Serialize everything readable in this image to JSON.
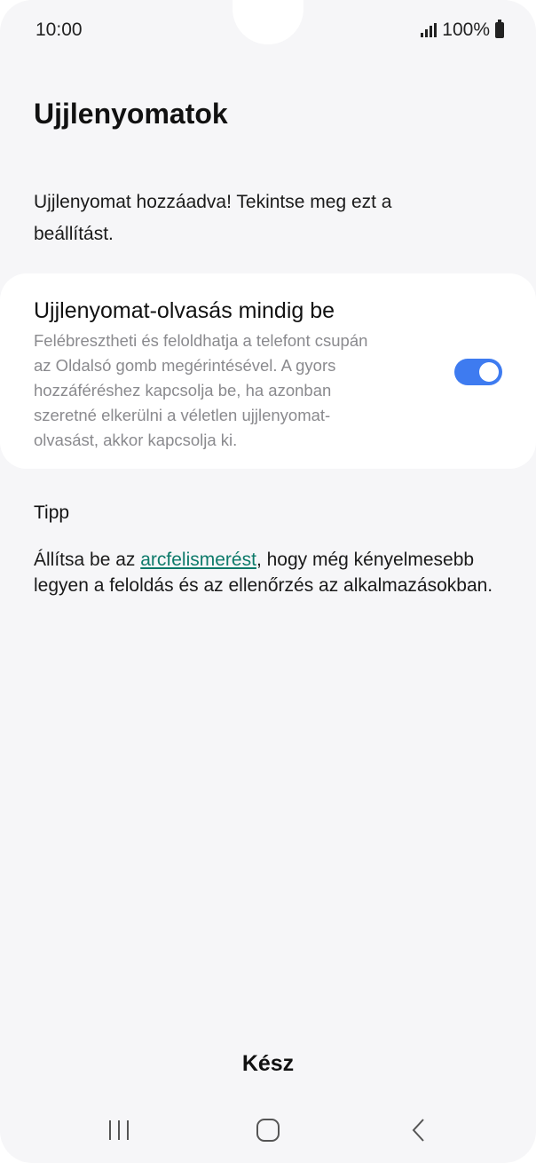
{
  "status_bar": {
    "time": "10:00",
    "battery": "100%"
  },
  "page": {
    "title": "Ujjlenyomatok",
    "intro": "Ujjlenyomat hozzáadva! Tekintse meg ezt a beállítást."
  },
  "setting": {
    "title": "Ujjlenyomat-olvasás mindig be",
    "description": "Felébresztheti és feloldhatja a telefont csupán az Oldalsó gomb megérintésével. A gyors hozzáféréshez kapcsolja be, ha azonban szeretné elkerülni a véletlen ujjlenyomat-olvasást, akkor kapcsolja ki.",
    "toggle_on": true,
    "toggle_color": "#3e7bf0"
  },
  "tip": {
    "heading": "Tipp",
    "text_before": "Állítsa be az ",
    "link_text": "arcfelismerést",
    "text_after": ", hogy még kényelmesebb legyen a feloldás és az ellenőrzés az alkalmazásokban.",
    "link_color": "#0d7a6a"
  },
  "footer": {
    "done_label": "Kész"
  },
  "nav": {
    "recent_icon": "recent-apps-icon",
    "home_icon": "home-icon",
    "back_icon": "back-icon"
  }
}
